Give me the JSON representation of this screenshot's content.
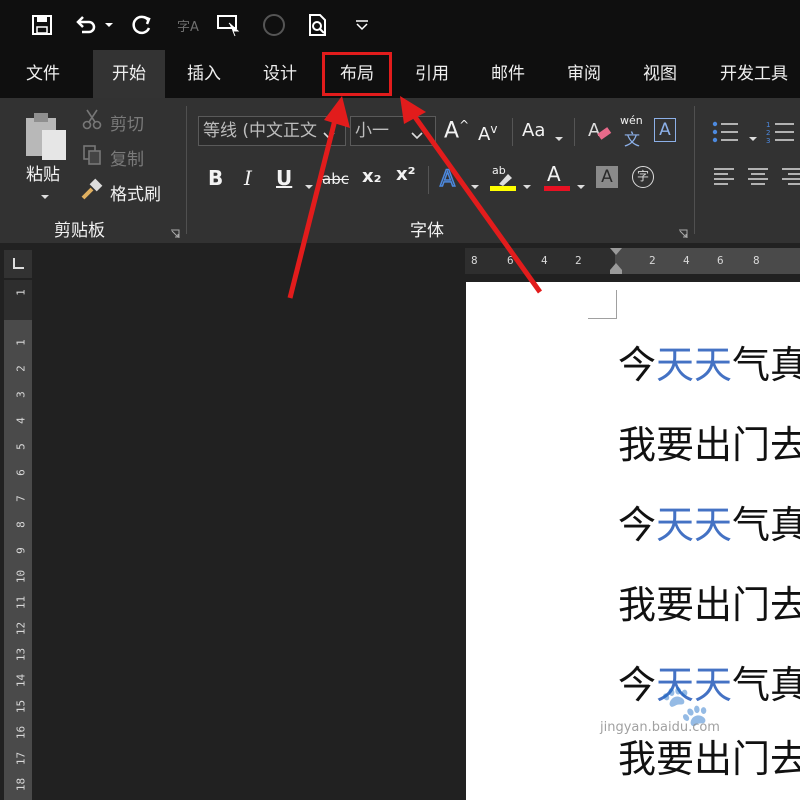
{
  "quick_access": {
    "items": [
      "save-icon",
      "undo-icon",
      "undo-dropdown-icon",
      "redo-icon",
      "spelling-icon",
      "touch-mode-icon",
      "record-icon",
      "print-preview-icon",
      "customize-dropdown-icon"
    ],
    "spelling_glyph": "字A"
  },
  "tabs": [
    {
      "label": "文件"
    },
    {
      "label": "开始"
    },
    {
      "label": "插入"
    },
    {
      "label": "设计"
    },
    {
      "label": "布局"
    },
    {
      "label": "引用"
    },
    {
      "label": "邮件"
    },
    {
      "label": "审阅"
    },
    {
      "label": "视图"
    },
    {
      "label": "开发工具"
    }
  ],
  "active_tab": "开始",
  "highlighted_tab": "布局",
  "clipboard": {
    "paste_label": "粘贴",
    "cut_label": "剪切",
    "copy_label": "复制",
    "format_painter_label": "格式刷",
    "group_label": "剪贴板"
  },
  "font": {
    "font_name": "等线 (中文正文",
    "font_size": "小一",
    "change_case_label": "Aa",
    "phonetic_label": "wén",
    "phonetic_char": "文",
    "char_border_label": "A",
    "bold_label": "B",
    "italic_label": "I",
    "underline_label": "U",
    "strike_label": "abc",
    "subscript_label": "x₂",
    "superscript_label": "x²",
    "enclose_label": "字",
    "highlight_label": "ab",
    "font_color_label": "A",
    "shading_label": "A",
    "group_label": "字体",
    "grow_label": "A",
    "shrink_label": "A"
  },
  "colors": {
    "highlight_yellow": "#ffff00",
    "font_color_red": "#e81123",
    "annotation_red": "#e21c1c",
    "text_blue": "#4472c4"
  },
  "h_ruler_ticks": [
    "8",
    "6",
    "4",
    "2",
    "2",
    "4",
    "6",
    "8"
  ],
  "v_ruler_ticks": [
    "1",
    "1",
    "2",
    "3",
    "4",
    "5",
    "6",
    "7",
    "8",
    "9",
    "10",
    "11",
    "12",
    "13",
    "14",
    "15",
    "16",
    "17",
    "18"
  ],
  "document": {
    "lines": [
      {
        "a": "今",
        "b": "天天",
        "c": "气真"
      },
      {
        "a": "我要出门去",
        "b": "",
        "c": ""
      },
      {
        "a": "今",
        "b": "天天",
        "c": "气真"
      },
      {
        "a": "我要出门去",
        "b": "",
        "c": ""
      },
      {
        "a": "今",
        "b": "天天",
        "c": "气真"
      },
      {
        "a": "我要出门去",
        "b": "",
        "c": ""
      }
    ]
  },
  "watermark": {
    "text": "jingyan.baidu.com"
  }
}
